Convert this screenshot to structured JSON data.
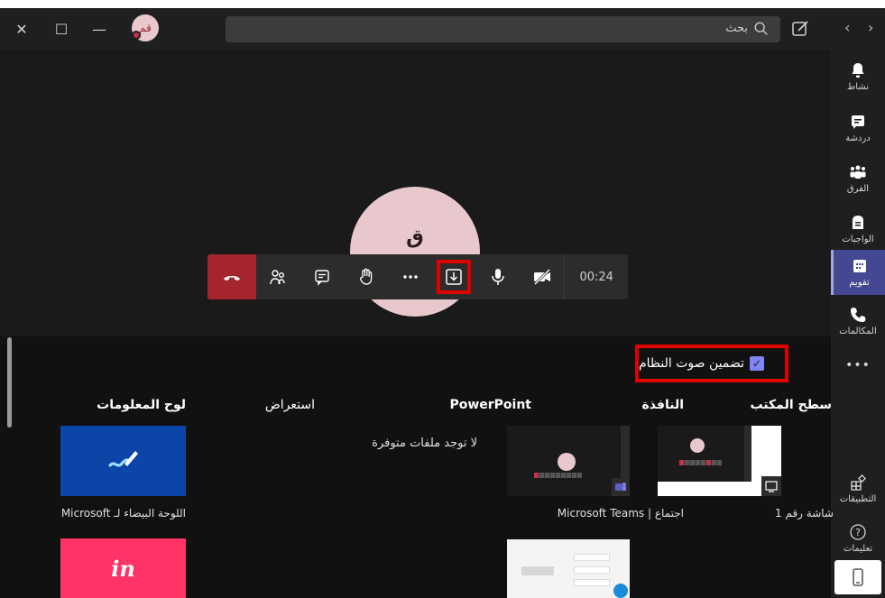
{
  "titlebar": {
    "avatar_initials": "قم",
    "search_placeholder": "بحث",
    "close_glyph": "✕",
    "maximize_glyph": "☐",
    "minimize_glyph": "—",
    "back_glyph": "‹",
    "forward_glyph": "›"
  },
  "rail": {
    "items": [
      {
        "label": "نشاط",
        "icon": "bell-icon"
      },
      {
        "label": "دردشة",
        "icon": "chat-icon"
      },
      {
        "label": "الفرق",
        "icon": "teams-icon"
      },
      {
        "label": "الواجبات",
        "icon": "assignments-icon"
      },
      {
        "label": "تقويم",
        "icon": "calendar-icon",
        "active": true
      },
      {
        "label": "المكالمات",
        "icon": "phone-icon"
      },
      {
        "label": "•••",
        "icon": "more-icon"
      },
      {
        "label": "التطبيقات",
        "icon": "apps-icon"
      },
      {
        "label": "تعليمات",
        "icon": "help-icon"
      }
    ]
  },
  "call": {
    "avatar_initials": "ق",
    "timer": "00:24"
  },
  "share_panel": {
    "include_system_audio": "تضمين صوت النظام",
    "columns": {
      "desktop": "سطح المكتب",
      "window": "النافذة",
      "powerpoint": "PowerPoint",
      "browse": "استعراض",
      "whiteboard": "لوح المعلومات"
    },
    "desktop_caption": "شاشة رقم 1",
    "window_caption": "اجتماع | Microsoft Teams",
    "no_files": "لا توجد ملفات متوفرة",
    "whiteboard_caption": "اللوحة البيضاء لـ Microsoft",
    "invision_logo": "in"
  },
  "colors": {
    "accent": "#444791",
    "hangup": "#a4262c",
    "highlight": "#e00000",
    "checkbox": "#7f85f5",
    "whiteboard_bg": "#0b45a8",
    "invision_bg": "#ff3366"
  }
}
